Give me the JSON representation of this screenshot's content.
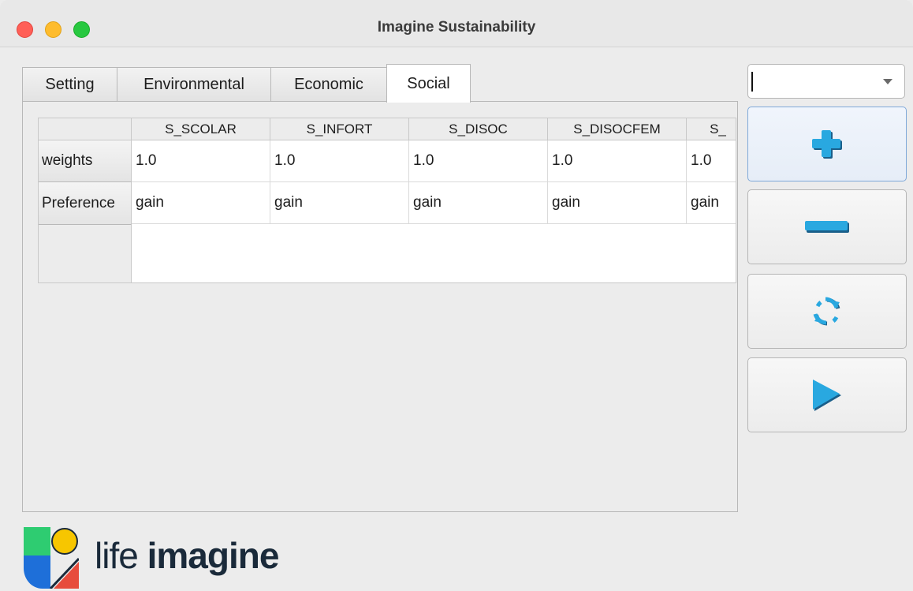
{
  "window": {
    "title": "Imagine Sustainability"
  },
  "tabs": [
    {
      "label": "Setting",
      "active": false
    },
    {
      "label": "Environmental",
      "active": false
    },
    {
      "label": "Economic",
      "active": false
    },
    {
      "label": "Social",
      "active": true
    }
  ],
  "table": {
    "columns": [
      "S_SCOLAR",
      "S_INFORT",
      "S_DISOC",
      "S_DISOCFEM",
      "S_"
    ],
    "rows": [
      {
        "header": "weights",
        "cells": [
          "1.0",
          "1.0",
          "1.0",
          "1.0",
          "1.0"
        ]
      },
      {
        "header": "Preference",
        "cells": [
          "gain",
          "gain",
          "gain",
          "gain",
          "gain"
        ]
      }
    ]
  },
  "combo": {
    "value": ""
  },
  "side_buttons": [
    {
      "icon": "plus-icon"
    },
    {
      "icon": "minus-icon"
    },
    {
      "icon": "refresh-icon"
    },
    {
      "icon": "play-icon"
    }
  ],
  "brand": {
    "prefix": "life",
    "name": "imagine"
  },
  "colors": {
    "accent_blue": "#29a8e0",
    "close": "#ff5f57",
    "minimize": "#febc2e",
    "maximize": "#28c840",
    "logo_green": "#2ecc71",
    "logo_blue": "#1e6fd9",
    "logo_yellow": "#f7c600",
    "logo_red": "#e74c3c"
  }
}
